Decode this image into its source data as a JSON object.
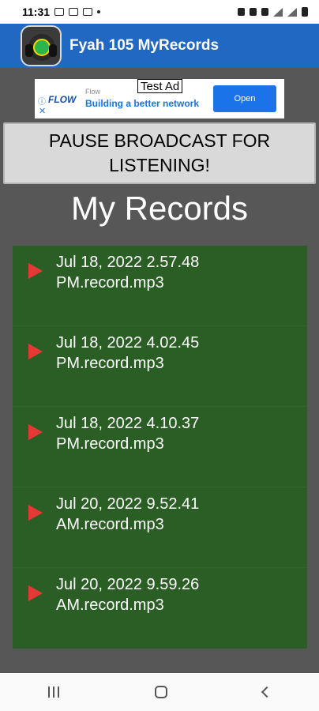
{
  "status_bar": {
    "time": "11:31"
  },
  "app_bar": {
    "title": "Fyah 105 MyRecords"
  },
  "ad": {
    "tag": "Test Ad",
    "brand": "FLOW",
    "sponsor": "Flow",
    "tagline": "Building a better network",
    "open_label": "Open",
    "info_icon": "info-icon",
    "close_icon": "close-icon"
  },
  "pause_button": {
    "label": "PAUSE BROADCAST FOR LISTENING!"
  },
  "page_title": "My Records",
  "records": [
    {
      "label": "Jul 18, 2022 2.57.48 PM.record.mp3"
    },
    {
      "label": "Jul 18, 2022 4.02.45 PM.record.mp3"
    },
    {
      "label": "Jul 18, 2022 4.10.37 PM.record.mp3"
    },
    {
      "label": "Jul 20, 2022 9.52.41 AM.record.mp3"
    },
    {
      "label": "Jul 20, 2022 9.59.26 AM.record.mp3"
    }
  ],
  "colors": {
    "app_bar": "#2168c2",
    "background": "#575757",
    "record_list": "#2a5e24",
    "play_icon": "#e53935"
  }
}
